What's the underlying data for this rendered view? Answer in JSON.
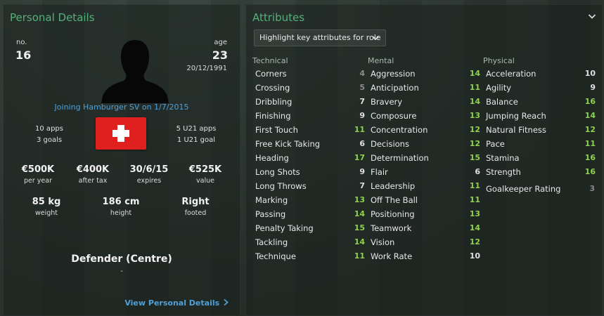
{
  "personal": {
    "title": "Personal Details",
    "no_label": "no.",
    "no_value": "16",
    "age_label": "age",
    "age_value": "23",
    "dob": "20/12/1991",
    "joining": "Joining Hamburger SV on 1/7/2015",
    "apps": "10 apps",
    "goals": "3 goals",
    "u21_apps": "5 U21 apps",
    "u21_goals": "1 U21 goal",
    "finance": [
      {
        "value": "€500K",
        "caption": "per year"
      },
      {
        "value": "€400K",
        "caption": "after tax"
      },
      {
        "value": "30/6/15",
        "caption": "expires"
      },
      {
        "value": "€525K",
        "caption": "value"
      }
    ],
    "physical_info": [
      {
        "value": "85 kg",
        "caption": "weight"
      },
      {
        "value": "186 cm",
        "caption": "height"
      },
      {
        "value": "Right",
        "caption": "footed"
      }
    ],
    "position": "Defender (Centre)",
    "position_sub": "-",
    "view_link": "View Personal Details",
    "flag_colors": {
      "field": "#e0201e",
      "cross": "#ffffff"
    }
  },
  "attributes": {
    "title": "Attributes",
    "dropdown_label": "Highlight key attributes for role",
    "technical": {
      "heading": "Technical",
      "items": [
        {
          "name": "Corners",
          "value": "4"
        },
        {
          "name": "Crossing",
          "value": "5"
        },
        {
          "name": "Dribbling",
          "value": "7"
        },
        {
          "name": "Finishing",
          "value": "9"
        },
        {
          "name": "First Touch",
          "value": "11"
        },
        {
          "name": "Free Kick Taking",
          "value": "6"
        },
        {
          "name": "Heading",
          "value": "17"
        },
        {
          "name": "Long Shots",
          "value": "9"
        },
        {
          "name": "Long Throws",
          "value": "7"
        },
        {
          "name": "Marking",
          "value": "13"
        },
        {
          "name": "Passing",
          "value": "14"
        },
        {
          "name": "Penalty Taking",
          "value": "15"
        },
        {
          "name": "Tackling",
          "value": "14"
        },
        {
          "name": "Technique",
          "value": "11"
        }
      ]
    },
    "mental": {
      "heading": "Mental",
      "items": [
        {
          "name": "Aggression",
          "value": "14"
        },
        {
          "name": "Anticipation",
          "value": "11"
        },
        {
          "name": "Bravery",
          "value": "14"
        },
        {
          "name": "Composure",
          "value": "13"
        },
        {
          "name": "Concentration",
          "value": "12"
        },
        {
          "name": "Decisions",
          "value": "12"
        },
        {
          "name": "Determination",
          "value": "15"
        },
        {
          "name": "Flair",
          "value": "6"
        },
        {
          "name": "Leadership",
          "value": "11"
        },
        {
          "name": "Off The Ball",
          "value": "11"
        },
        {
          "name": "Positioning",
          "value": "13"
        },
        {
          "name": "Teamwork",
          "value": "14"
        },
        {
          "name": "Vision",
          "value": "12"
        },
        {
          "name": "Work Rate",
          "value": "10"
        }
      ]
    },
    "physical": {
      "heading": "Physical",
      "items": [
        {
          "name": "Acceleration",
          "value": "10"
        },
        {
          "name": "Agility",
          "value": "9"
        },
        {
          "name": "Balance",
          "value": "16"
        },
        {
          "name": "Jumping Reach",
          "value": "14"
        },
        {
          "name": "Natural Fitness",
          "value": "12"
        },
        {
          "name": "Pace",
          "value": "11"
        },
        {
          "name": "Stamina",
          "value": "16"
        },
        {
          "name": "Strength",
          "value": "16"
        }
      ]
    },
    "goalkeeper_rating": {
      "name": "Goalkeeper Rating",
      "value": "3"
    }
  },
  "colors": {
    "title_green": "#57b07a",
    "link_blue": "#4fa0d8",
    "value_dim": "#8a8a8a",
    "value_normal": "#e0e0e0",
    "value_good": "#8fd24e"
  }
}
